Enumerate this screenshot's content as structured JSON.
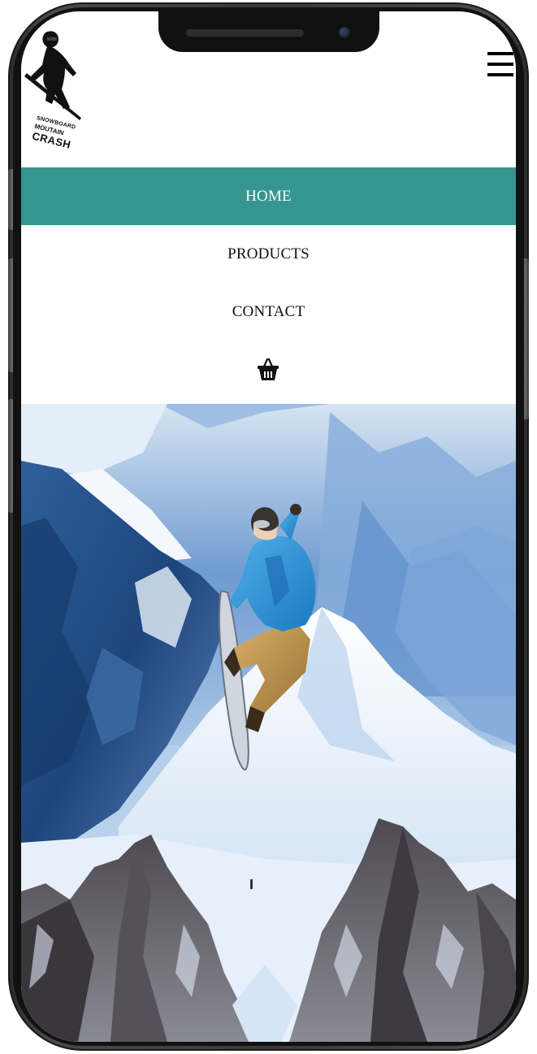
{
  "brand": {
    "logo_line1": "SNOWBOARD",
    "logo_line2": "MOUTAIN",
    "logo_line3": "CRASH"
  },
  "nav": {
    "items": [
      {
        "label": "HOME",
        "active": true
      },
      {
        "label": "PRODUCTS",
        "active": false
      },
      {
        "label": "CONTACT",
        "active": false
      }
    ],
    "cart_icon": "basket-icon",
    "menu_icon": "hamburger-icon"
  },
  "colors": {
    "accent": "#35968f",
    "text": "#111111",
    "background": "#ffffff"
  },
  "hero": {
    "image": "snowboarder-mountains"
  }
}
